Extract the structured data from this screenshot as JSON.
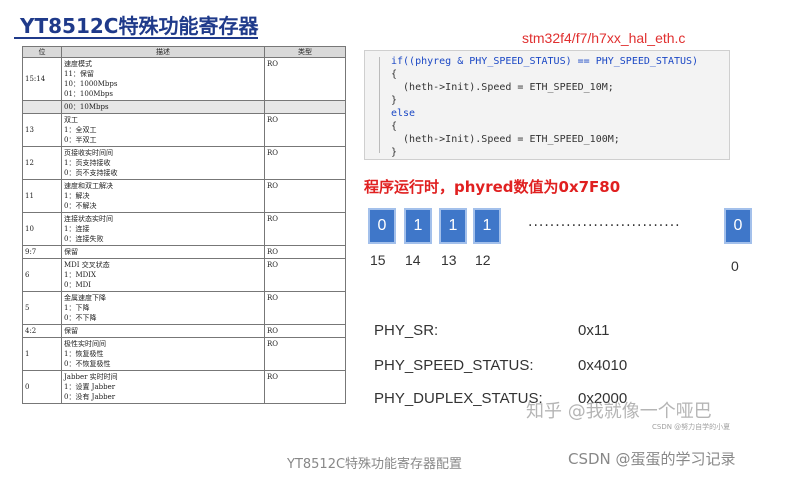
{
  "title": "YT8512C特殊功能寄存器",
  "table": {
    "headers": [
      "位",
      "描述",
      "类型"
    ],
    "rows": [
      {
        "bit": "15:14",
        "desc": [
          "速度模式",
          "11：保留",
          "10：1000Mbps",
          "01：100Mbps"
        ],
        "type": "RO"
      },
      {
        "bit": "",
        "desc": [
          "00：10Mbps"
        ],
        "type": "",
        "shade": true
      },
      {
        "bit": "13",
        "desc": [
          "双工",
          "1：全双工",
          "0：半双工"
        ],
        "type": "RO"
      },
      {
        "bit": "12",
        "desc": [
          "页接收实时间间",
          "1：页支持接收",
          "0：页不支持接收"
        ],
        "type": "RO"
      },
      {
        "bit": "11",
        "desc": [
          "速度和双工解决",
          "1：解决",
          "0：不解决"
        ],
        "type": "RO"
      },
      {
        "bit": "10",
        "desc": [
          "连接状态实时间",
          "1：连接",
          "0：连接失败"
        ],
        "type": "RO"
      },
      {
        "bit": "9:7",
        "desc": [
          "保留"
        ],
        "type": "RO"
      },
      {
        "bit": "6",
        "desc": [
          "MDI 交叉状态",
          "1：MDIX",
          "0：MDI"
        ],
        "type": "RO"
      },
      {
        "bit": "5",
        "desc": [
          "金属速度下降",
          "1：下降",
          "0：不下降"
        ],
        "type": "RO"
      },
      {
        "bit": "4:2",
        "desc": [
          "保留"
        ],
        "type": "RO"
      },
      {
        "bit": "1",
        "desc": [
          "极性实时间间",
          "1：恢复极性",
          "0：不恢复极性"
        ],
        "type": "RO"
      },
      {
        "bit": "0",
        "desc": [
          "Jabber 实时时间",
          "1：设置 Jabber",
          "0：没有 Jabber"
        ],
        "type": "RO"
      }
    ]
  },
  "code": {
    "path": "stm32f4/f7/h7xx_hal_eth.c",
    "lines": [
      "if((phyreg & PHY_SPEED_STATUS) == PHY_SPEED_STATUS)",
      "{",
      "  (heth->Init).Speed = ETH_SPEED_10M;",
      "}",
      "else",
      "{",
      "  (heth->Init).Speed = ETH_SPEED_100M;",
      "}"
    ]
  },
  "runtime_note": "程序运行时，phyred数值为0x7F80",
  "bits": {
    "boxes": [
      "0",
      "1",
      "1",
      "1",
      "0"
    ],
    "numbers": [
      "15",
      "14",
      "13",
      "12",
      "0"
    ],
    "ellipsis": "............................"
  },
  "registers": [
    {
      "label": "PHY_SR:",
      "value": "0x11"
    },
    {
      "label": "PHY_SPEED_STATUS:",
      "value": "0x4010"
    },
    {
      "label": "PHY_DUPLEX_STATUS:",
      "value": "0x2000"
    }
  ],
  "watermark": "知乎 @我就像一个哑巴",
  "watermark_small": "CSDN @努力自学的小夏",
  "caption": "YT8512C特殊功能寄存器配置",
  "csdn_credit": "CSDN @蛋蛋的学习记录",
  "colors": {
    "title": "#1f3a8a",
    "accent_red": "#e02020",
    "bit_box": "#3f77c9"
  }
}
